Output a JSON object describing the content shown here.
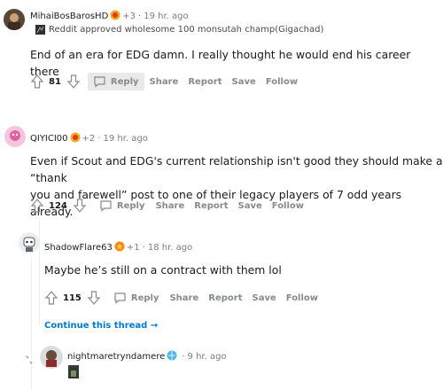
{
  "comments": [
    {
      "username": "MihaiBosBarosHD",
      "award_count": "+3",
      "time": "19 hr. ago",
      "flair": "Reddit approved wholesome 100 monsutah champ(Gigachad)",
      "body": "End of an era for EDG damn. I really thought he would end his career there",
      "score": "81",
      "reply_label": "Reply",
      "share_label": "Share",
      "report_label": "Report",
      "save_label": "Save",
      "follow_label": "Follow"
    },
    {
      "username": "QIYICI00",
      "award_count": "+2",
      "time": "19 hr. ago",
      "body_line1": "Even if Scout and EDG's current relationship isn't good they should make a “thank",
      "body_line2": "you and farewell” post to one of their legacy players of 7 odd years already.",
      "score": "124",
      "reply_label": "Reply",
      "share_label": "Share",
      "report_label": "Report",
      "save_label": "Save",
      "follow_label": "Follow"
    },
    {
      "username": "ShadowFlare63",
      "award_count": "+1",
      "time": "18 hr. ago",
      "body": "Maybe he’s still on a contract with them lol",
      "score": "115",
      "reply_label": "Reply",
      "share_label": "Share",
      "report_label": "Report",
      "save_label": "Save",
      "follow_label": "Follow"
    },
    {
      "username": "nightmaretryndamere",
      "time": "9 hr. ago"
    }
  ],
  "continue_thread": "Continue this thread",
  "separator": "·",
  "colors": {
    "text": "#1a1a1b",
    "muted": "#878a8c",
    "link": "#0079d3",
    "reply_highlight": "#e9e9e9"
  }
}
